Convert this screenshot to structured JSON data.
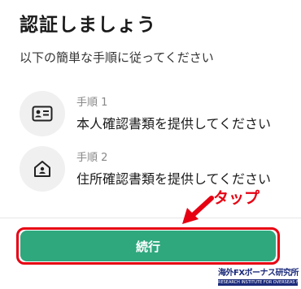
{
  "header": {
    "title": "認証しましょう",
    "subtitle": "以下の簡単な手順に従ってください"
  },
  "steps": [
    {
      "label": "手順 1",
      "text": "本人確認書類を提供してください",
      "icon": "id-card-icon"
    },
    {
      "label": "手順 2",
      "text": "住所確認書類を提供してください",
      "icon": "home-icon"
    }
  ],
  "annotation": {
    "tap_label": "タップ",
    "color": "#e60012"
  },
  "footer": {
    "continue_label": "続行",
    "button_color": "#2fa87e"
  },
  "watermark": {
    "main": "海外FXボーナス研究所",
    "sub": "RESEARCH INSTITUTE FOR OVERSEAS FX BONUS"
  }
}
